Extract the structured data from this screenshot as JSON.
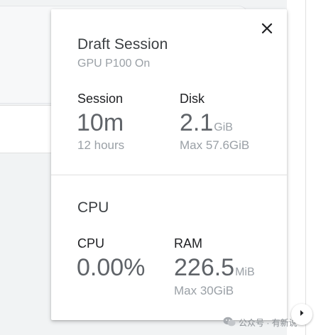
{
  "popover": {
    "title": "Draft Session",
    "subtitle": "GPU P100 On",
    "session": {
      "label": "Session",
      "value": "10m",
      "sub": "12 hours"
    },
    "disk": {
      "label": "Disk",
      "value": "2.1",
      "unit": "GiB",
      "sub": "Max 57.6GiB"
    },
    "cpu_section": {
      "title": "CPU",
      "cpu": {
        "label": "CPU",
        "value": "0.00%"
      },
      "ram": {
        "label": "RAM",
        "value": "226.5",
        "unit": "MiB",
        "sub": "Max 30GiB"
      }
    }
  },
  "watermark": {
    "text": "公众号 · 有新说"
  },
  "icons": {
    "close": "close-icon",
    "scroll": "chevron-right-icon",
    "wechat": "wechat-logo"
  },
  "colors": {
    "title": "#3c4043",
    "muted": "#9aa0a6",
    "value": "#5f6368",
    "label": "#202124"
  }
}
